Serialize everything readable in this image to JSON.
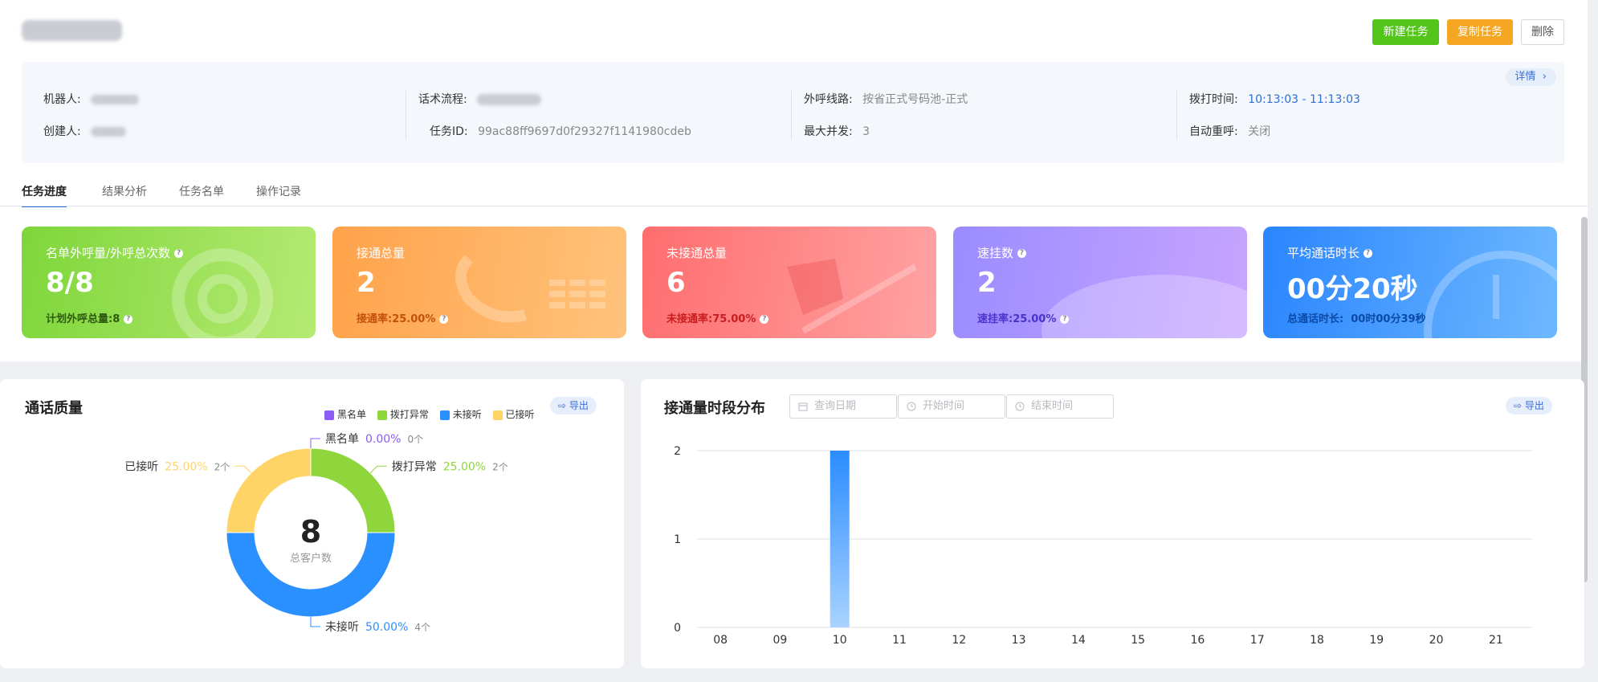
{
  "header": {
    "title": "",
    "new_button": "新建任务",
    "copy_button": "复制任务",
    "delete_button": "删除"
  },
  "info": {
    "detail_label": "详情",
    "robot_label": "机器人:",
    "creator_label": "创建人:",
    "flow_label": "话术流程:",
    "task_id_label": "任务ID:",
    "task_id_value": "99ac88ff9697d0f29327f1141980cdeb",
    "line_label": "外呼线路:",
    "line_value": "按省正式号码池-正式",
    "concurrency_label": "最大并发:",
    "concurrency_value": "3",
    "dial_time_label": "拨打时间:",
    "dial_time_value": "10:13:03 - 11:13:03",
    "auto_redial_label": "自动重呼:",
    "auto_redial_value": "关闭"
  },
  "tabs": [
    "任务进度",
    "结果分析",
    "任务名单",
    "操作记录"
  ],
  "cards": [
    {
      "label": "名单外呼量/外呼总次数",
      "value": "8/8",
      "sub_label": "计划外呼总量:",
      "sub_value": "8"
    },
    {
      "label": "接通总量",
      "value": "2",
      "sub_label": "接通率:",
      "sub_value": "25.00%"
    },
    {
      "label": "未接通总量",
      "value": "6",
      "sub_label": "未接通率:",
      "sub_value": "75.00%"
    },
    {
      "label": "速挂数",
      "value": "2",
      "sub_label": "速挂率:",
      "sub_value": "25.00%"
    },
    {
      "label": "平均通话时长",
      "value": "00分20秒",
      "sub_label": "总通话时长:",
      "sub_value": "00时00分39秒"
    }
  ],
  "quality": {
    "title": "通话质量",
    "export_label": "导出",
    "center_value": "8",
    "center_label": "总客户数",
    "legend": [
      {
        "name": "黑名单",
        "color": "#8b5cf6"
      },
      {
        "name": "拨打异常",
        "color": "#8fd63c"
      },
      {
        "name": "未接听",
        "color": "#2a90ff"
      },
      {
        "name": "已接听",
        "color": "#ffd466"
      }
    ]
  },
  "distribution": {
    "title": "接通量时段分布",
    "export_label": "导出",
    "date_placeholder": "查询日期",
    "start_placeholder": "开始时间",
    "end_placeholder": "结束时间"
  },
  "chart_data": [
    {
      "type": "pie",
      "title": "通话质量",
      "series": [
        {
          "name": "黑名单",
          "percent": "0.00%",
          "count": "0个",
          "value": 0,
          "color": "#8b5cf6"
        },
        {
          "name": "拨打异常",
          "percent": "25.00%",
          "count": "2个",
          "value": 2,
          "color": "#8fd63c"
        },
        {
          "name": "未接听",
          "percent": "50.00%",
          "count": "4个",
          "value": 4,
          "color": "#2a90ff"
        },
        {
          "name": "已接听",
          "percent": "25.00%",
          "count": "2个",
          "value": 2,
          "color": "#ffd466"
        }
      ],
      "total": 8
    },
    {
      "type": "bar",
      "title": "接通量时段分布",
      "categories": [
        "08",
        "09",
        "10",
        "11",
        "12",
        "13",
        "14",
        "15",
        "16",
        "17",
        "18",
        "19",
        "20",
        "21"
      ],
      "values": [
        0,
        0,
        2,
        0,
        0,
        0,
        0,
        0,
        0,
        0,
        0,
        0,
        0,
        0
      ],
      "ylim": [
        0,
        2
      ],
      "yticks": [
        "0",
        "1",
        "2"
      ]
    }
  ]
}
